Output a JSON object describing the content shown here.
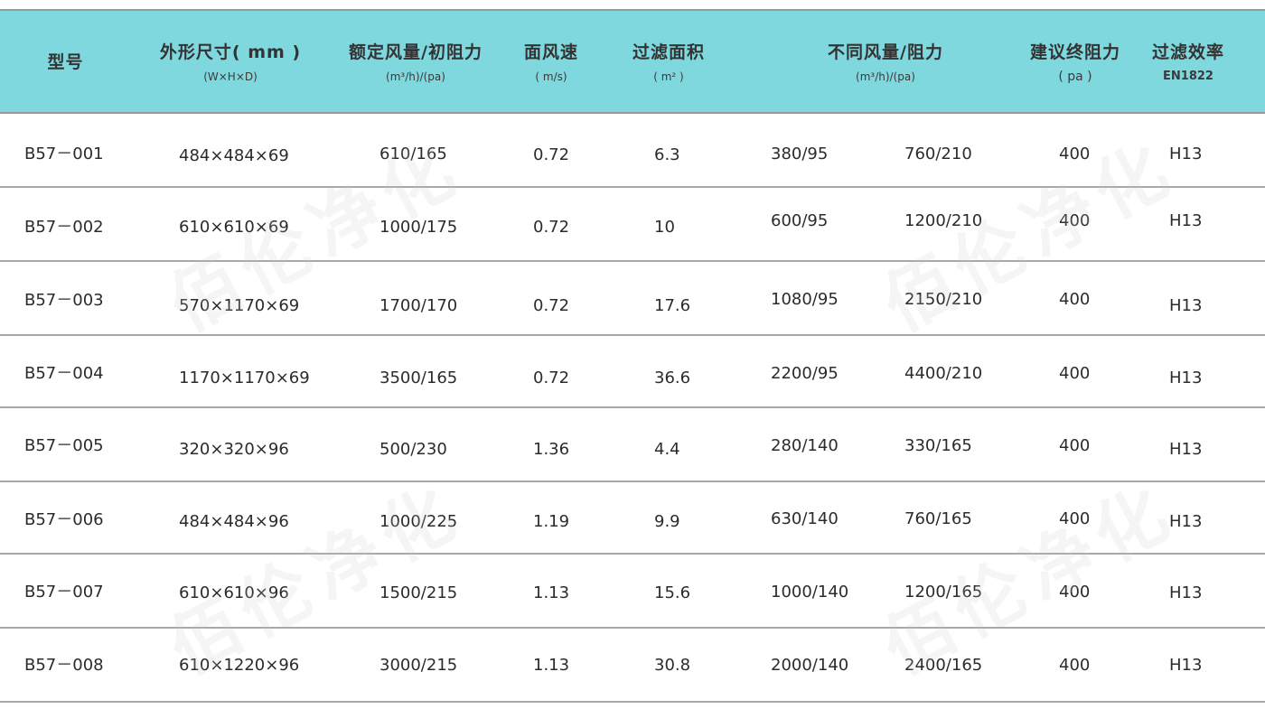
{
  "headers": {
    "model": {
      "main": "型号",
      "sub": ""
    },
    "size": {
      "main": "外形尺寸( mm )",
      "sub": "(W×H×D)"
    },
    "rated": {
      "main": "额定风量/初阻力",
      "sub": "(m³/h)/(pa)"
    },
    "speed": {
      "main": "面风速",
      "sub": "( m/s)"
    },
    "area": {
      "main": "过滤面积",
      "sub": "( m² )"
    },
    "flows": {
      "main": "不同风量/阻力",
      "sub": "(m³/h)/(pa)"
    },
    "final": {
      "main": "建议终阻力",
      "sub": "( pa )"
    },
    "eff": {
      "main": "过滤效率",
      "sub": "EN1822"
    }
  },
  "rows": [
    {
      "model": "B57－001",
      "size": "484×484×69",
      "rated": "610/165",
      "speed": "0.72",
      "area": "6.3",
      "f1": "380/95",
      "f2": "760/210",
      "final": "400",
      "eff": "H13"
    },
    {
      "model": "B57－002",
      "size": "610×610×69",
      "rated": "1000/175",
      "speed": "0.72",
      "area": "10",
      "f1": "600/95",
      "f2": "1200/210",
      "final": "400",
      "eff": "H13"
    },
    {
      "model": "B57－003",
      "size": "570×1170×69",
      "rated": "1700/170",
      "speed": "0.72",
      "area": "17.6",
      "f1": "1080/95",
      "f2": "2150/210",
      "final": "400",
      "eff": "H13"
    },
    {
      "model": "B57－004",
      "size": "1170×1170×69",
      "rated": "3500/165",
      "speed": "0.72",
      "area": "36.6",
      "f1": "2200/95",
      "f2": "4400/210",
      "final": "400",
      "eff": "H13"
    },
    {
      "model": "B57－005",
      "size": "320×320×96",
      "rated": "500/230",
      "speed": "1.36",
      "area": "4.4",
      "f1": "280/140",
      "f2": "330/165",
      "final": "400",
      "eff": "H13"
    },
    {
      "model": "B57－006",
      "size": "484×484×96",
      "rated": "1000/225",
      "speed": "1.19",
      "area": "9.9",
      "f1": "630/140",
      "f2": "760/165",
      "final": "400",
      "eff": "H13"
    },
    {
      "model": "B57－007",
      "size": "610×610×96",
      "rated": "1500/215",
      "speed": "1.13",
      "area": "15.6",
      "f1": "1000/140",
      "f2": "1200/165",
      "final": "400",
      "eff": "H13"
    },
    {
      "model": "B57－008",
      "size": "610×1220×96",
      "rated": "3000/215",
      "speed": "1.13",
      "area": "30.8",
      "f1": "2000/140",
      "f2": "2400/165",
      "final": "400",
      "eff": "H13"
    }
  ],
  "watermark": "佰伦净化",
  "colors": {
    "header_bg": "#7fd8de",
    "rule": "#a8a8a8",
    "text": "#2b2b2b"
  }
}
